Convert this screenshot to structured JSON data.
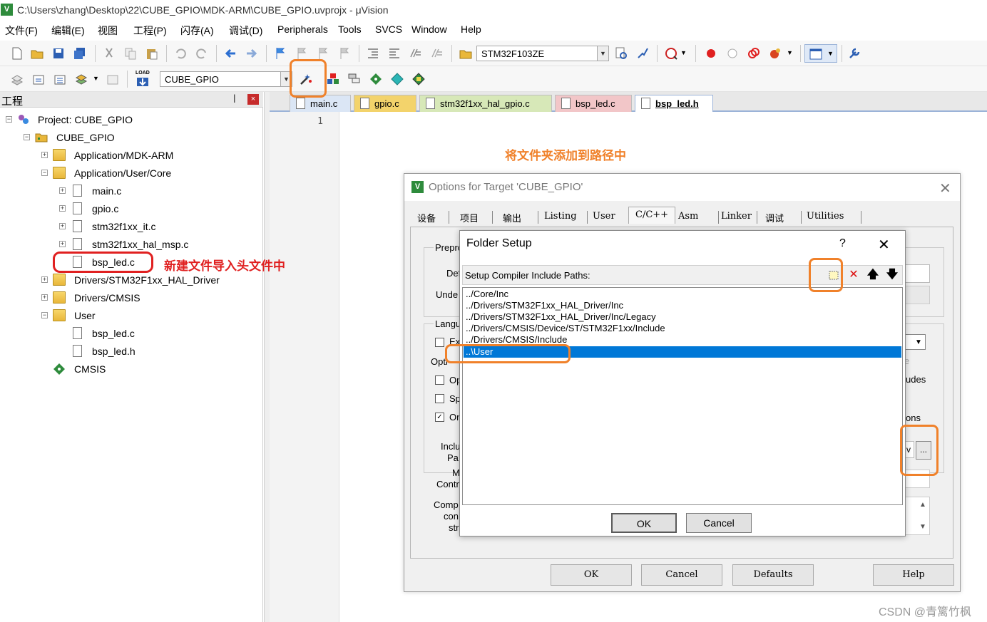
{
  "window": {
    "title": "C:\\Users\\zhang\\Desktop\\22\\CUBE_GPIO\\MDK-ARM\\CUBE_GPIO.uvprojx - μVision",
    "app_icon": "V"
  },
  "menu": [
    "文件(F)",
    "编辑(E)",
    "视图",
    "工程(P)",
    "闪存(A)",
    "调试(D)",
    "Peripherals",
    "Tools",
    "SVCS",
    "Window",
    "Help"
  ],
  "toolbar1": {
    "device": "STM32F103ZE"
  },
  "toolbar2": {
    "target": "CUBE_GPIO",
    "load_label": "LOAD"
  },
  "project_panel": {
    "title": "工程",
    "pin": "ᵖ",
    "close": "×",
    "tree": [
      {
        "label": "Project: CUBE_GPIO"
      },
      {
        "label": "CUBE_GPIO"
      },
      {
        "label": "Application/MDK-ARM"
      },
      {
        "label": "Application/User/Core"
      },
      {
        "label": "main.c"
      },
      {
        "label": "gpio.c"
      },
      {
        "label": "stm32f1xx_it.c"
      },
      {
        "label": "stm32f1xx_hal_msp.c"
      },
      {
        "label": "bsp_led.c"
      },
      {
        "label": "Drivers/STM32F1xx_HAL_Driver"
      },
      {
        "label": "Drivers/CMSIS"
      },
      {
        "label": "User"
      },
      {
        "label": "bsp_led.c"
      },
      {
        "label": "bsp_led.h"
      },
      {
        "label": "CMSIS"
      }
    ]
  },
  "editor": {
    "tabs": [
      "main.c",
      "gpio.c",
      "stm32f1xx_hal_gpio.c",
      "bsp_led.c",
      "bsp_led.h"
    ],
    "active_tab": "bsp_led.h",
    "line_number": "1"
  },
  "annotations": {
    "add_folder": "将文件夹添加到路径中",
    "new_file": "新建文件导入头文件中",
    "color_orange": "#f0812a",
    "color_red": "#e02020"
  },
  "options_dialog": {
    "title": "Options for Target 'CUBE_GPIO'",
    "close": "✕",
    "tabs": [
      "设备",
      "项目",
      "输出",
      "Listing",
      "User",
      "C/C++",
      "Asm",
      "Linker",
      "调试",
      "Utilities"
    ],
    "active_tab": "C/C++",
    "labels": {
      "prepro": "Prepro",
      "define": "Def",
      "undefine": "Unde",
      "language": "Langu",
      "execute": "Ex",
      "optim": "Opti",
      "opt1": "Op",
      "opt2": "Sp",
      "opt3": "On",
      "include": "Inclu",
      "paths": "Pa",
      "misc": "M",
      "controls": "Contr",
      "compiler": "Comp",
      "control": "con",
      "string": "str",
      "includes_r": "udes",
      "options_r": "ons",
      "e_r": "e",
      "v_r": "v"
    },
    "browse": "...",
    "buttons": [
      "OK",
      "Cancel",
      "Defaults",
      "Help"
    ]
  },
  "folder_setup": {
    "title": "Folder Setup",
    "help": "?",
    "close": "✕",
    "caption": "Setup Compiler Include Paths:",
    "paths": [
      "../Core/Inc",
      "../Drivers/STM32F1xx_HAL_Driver/Inc",
      "../Drivers/STM32F1xx_HAL_Driver/Inc/Legacy",
      "../Drivers/CMSIS/Device/ST/STM32F1xx/Include",
      "../Drivers/CMSIS/Include",
      "..\\User"
    ],
    "selected_index": 5,
    "ok": "OK",
    "cancel": "Cancel"
  },
  "watermark": "CSDN @青篱竹枫"
}
